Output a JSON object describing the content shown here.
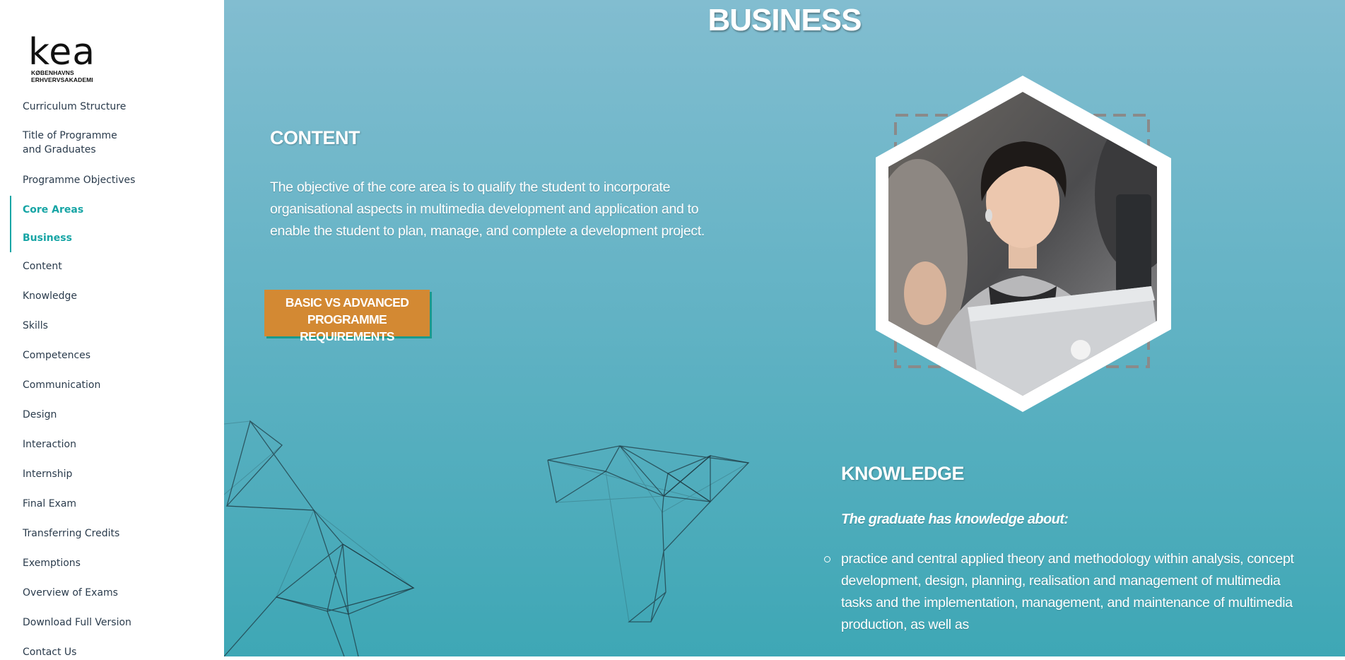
{
  "logo": {
    "wordmark": "kea",
    "subtitle": "KØBENHAVNS ERHVERVSAKADEMI"
  },
  "sidebar": {
    "items": [
      {
        "label": "Curriculum Structure"
      },
      {
        "label": "Title of Programme\nand Graduates"
      },
      {
        "label": "Programme Objectives"
      },
      {
        "label": "Core Areas"
      },
      {
        "label": "Business"
      },
      {
        "label": "Content"
      },
      {
        "label": "Knowledge"
      },
      {
        "label": "Skills"
      },
      {
        "label": "Competences"
      },
      {
        "label": "Communication"
      },
      {
        "label": "Design"
      },
      {
        "label": "Interaction"
      },
      {
        "label": "Internship"
      },
      {
        "label": "Final Exam"
      },
      {
        "label": "Transferring Credits"
      },
      {
        "label": "Exemptions"
      },
      {
        "label": "Overview of Exams"
      },
      {
        "label": "Download Full Version"
      },
      {
        "label": "Contact Us"
      }
    ]
  },
  "main": {
    "title": "BUSINESS",
    "content": {
      "heading": "CONTENT",
      "text": "The objective of the core area is to qualify the student to incorporate organisational aspects in multimedia development and application and to enable the student to plan, manage, and complete a development project.",
      "button_label": "BASIC VS ADVANCED PROGRAMME REQUIREMENTS"
    },
    "knowledge": {
      "heading": "KNOWLEDGE",
      "subheading": "The graduate has knowledge about:",
      "items": [
        "practice and central applied theory and methodology within analysis, concept development, design, planning, realisation and management of multimedia tasks and the implementation, management, and maintenance of multimedia production, as well as"
      ]
    }
  },
  "colors": {
    "accent": "#17a5a5",
    "button": "#d38933",
    "nav_text": "#2a3b4c"
  }
}
